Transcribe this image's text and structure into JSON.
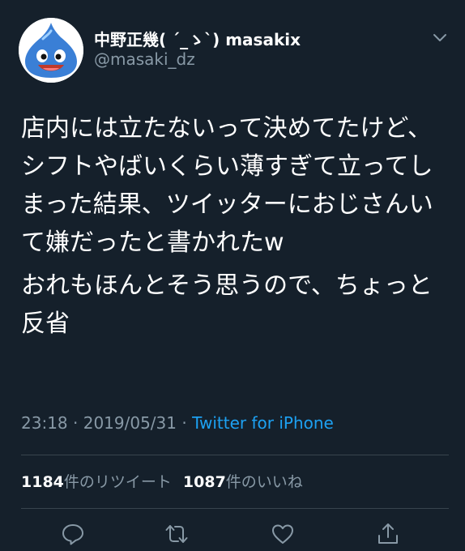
{
  "tweet": {
    "author": {
      "display_name": "中野正幾( ´_ゝ`) masakix",
      "handle": "@masaki_dz",
      "avatar_icon": "slime-avatar-icon"
    },
    "body_paragraphs": [
      "店内には立たないって決めてたけど、シフトやばいくらい薄すぎて立ってしまった結果、ツイッターにおじさんいて嫌だったと書かれたw",
      "おれもほんとそう思うので、ちょっと反省"
    ],
    "time": "23:18",
    "date": "2019/05/31",
    "separator": "·",
    "source": "Twitter for iPhone",
    "stats": {
      "retweets": "1184",
      "retweets_label": "件のリツイート",
      "likes": "1087",
      "likes_label": "件のいいね"
    }
  },
  "actions": [
    "reply-icon",
    "retweet-icon",
    "like-icon",
    "share-icon"
  ],
  "colors": {
    "background": "#15202b",
    "secondary_text": "#8899a6",
    "link": "#1da1f2",
    "divider": "#38444d",
    "avatar_slime": "#3a7fd6"
  }
}
